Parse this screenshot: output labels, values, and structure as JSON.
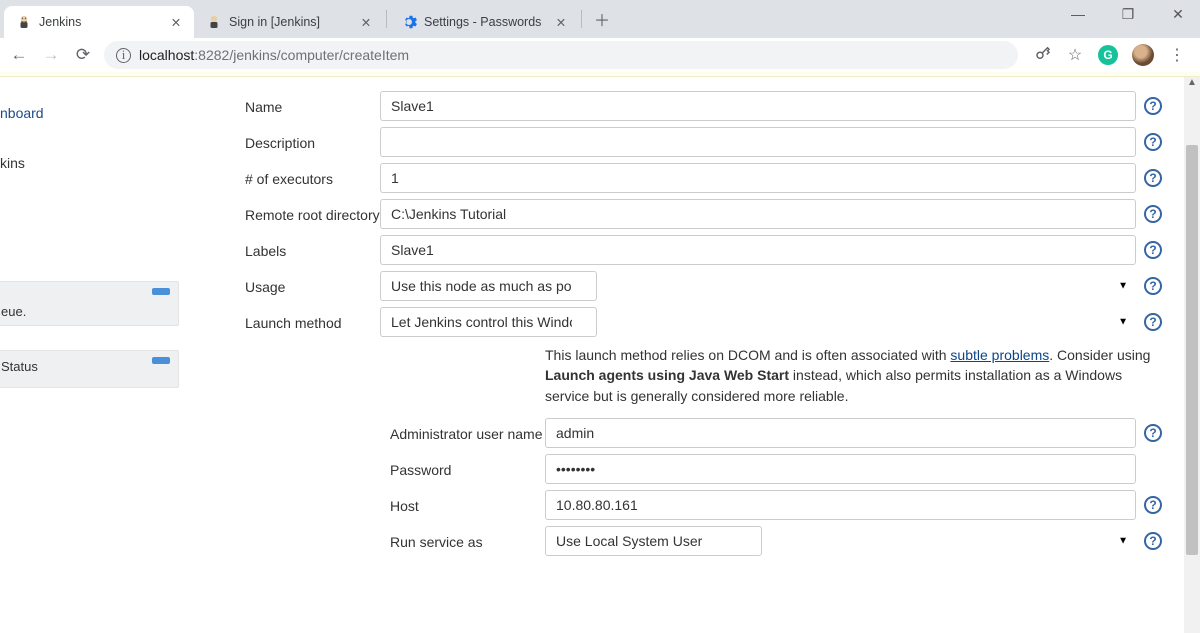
{
  "browser": {
    "tabs": [
      {
        "title": "Jenkins",
        "active": true
      },
      {
        "title": "Sign in [Jenkins]",
        "active": false
      },
      {
        "title": "Settings - Passwords",
        "active": false
      }
    ],
    "url_host": "localhost",
    "url_port": ":8282",
    "url_path": "/jenkins/computer/createItem"
  },
  "sidebar": {
    "item_dashboard": "nboard",
    "item_jenkins": "kins",
    "box1_text": "eue.",
    "status_link": "Status"
  },
  "form": {
    "name": {
      "label": "Name",
      "value": "Slave1"
    },
    "description": {
      "label": "Description",
      "value": ""
    },
    "executors": {
      "label": "# of executors",
      "value": "1"
    },
    "remote_root": {
      "label": "Remote root directory",
      "value": "C:\\Jenkins Tutorial"
    },
    "labels": {
      "label": "Labels",
      "value": "Slave1"
    },
    "usage": {
      "label": "Usage",
      "value": "Use this node as much as possible"
    },
    "launch": {
      "label": "Launch method",
      "value": "Let Jenkins control this Windows slave as a Windows service"
    },
    "note_pre": "This launch method relies on DCOM and is often associated with ",
    "note_link": "subtle problems",
    "note_mid": ". Consider using ",
    "note_bold": "Launch agents using Java Web Start",
    "note_post": " instead, which also permits installation as a Windows service but is generally considered more reliable.",
    "admin_user": {
      "label": "Administrator user name",
      "value": "admin"
    },
    "password": {
      "label": "Password",
      "value": "••••••••"
    },
    "host": {
      "label": "Host",
      "value": "10.80.80.161"
    },
    "run_as": {
      "label": "Run service as",
      "value": "Use Local System User"
    }
  }
}
